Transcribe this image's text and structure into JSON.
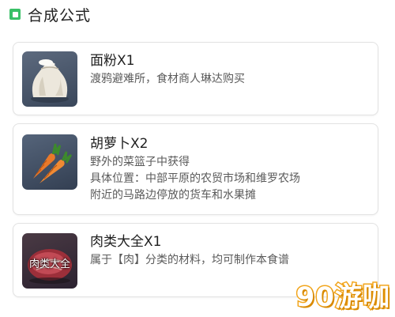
{
  "header": {
    "title": "合成公式",
    "icon": "square-icon",
    "accent_color": "#39c067"
  },
  "items": [
    {
      "name": "面粉X1",
      "thumb_icon": "flour-sack-icon",
      "desc_lines": [
        "渡鸦避难所，食材商人琳达购买"
      ]
    },
    {
      "name": "胡萝卜X2",
      "thumb_icon": "carrot-icon",
      "desc_lines": [
        "野外的菜篮子中获得",
        "具体位置：中部平原的农贸市场和维罗农场",
        "附近的马路边停放的货车和水果摊"
      ]
    },
    {
      "name": "肉类大全X1",
      "thumb_icon": "meat-icon",
      "thumb_label": "肉类大全",
      "desc_lines": [
        "属于【肉】分类的材料，均可制作本食谱"
      ]
    }
  ],
  "watermark": "90游咖"
}
